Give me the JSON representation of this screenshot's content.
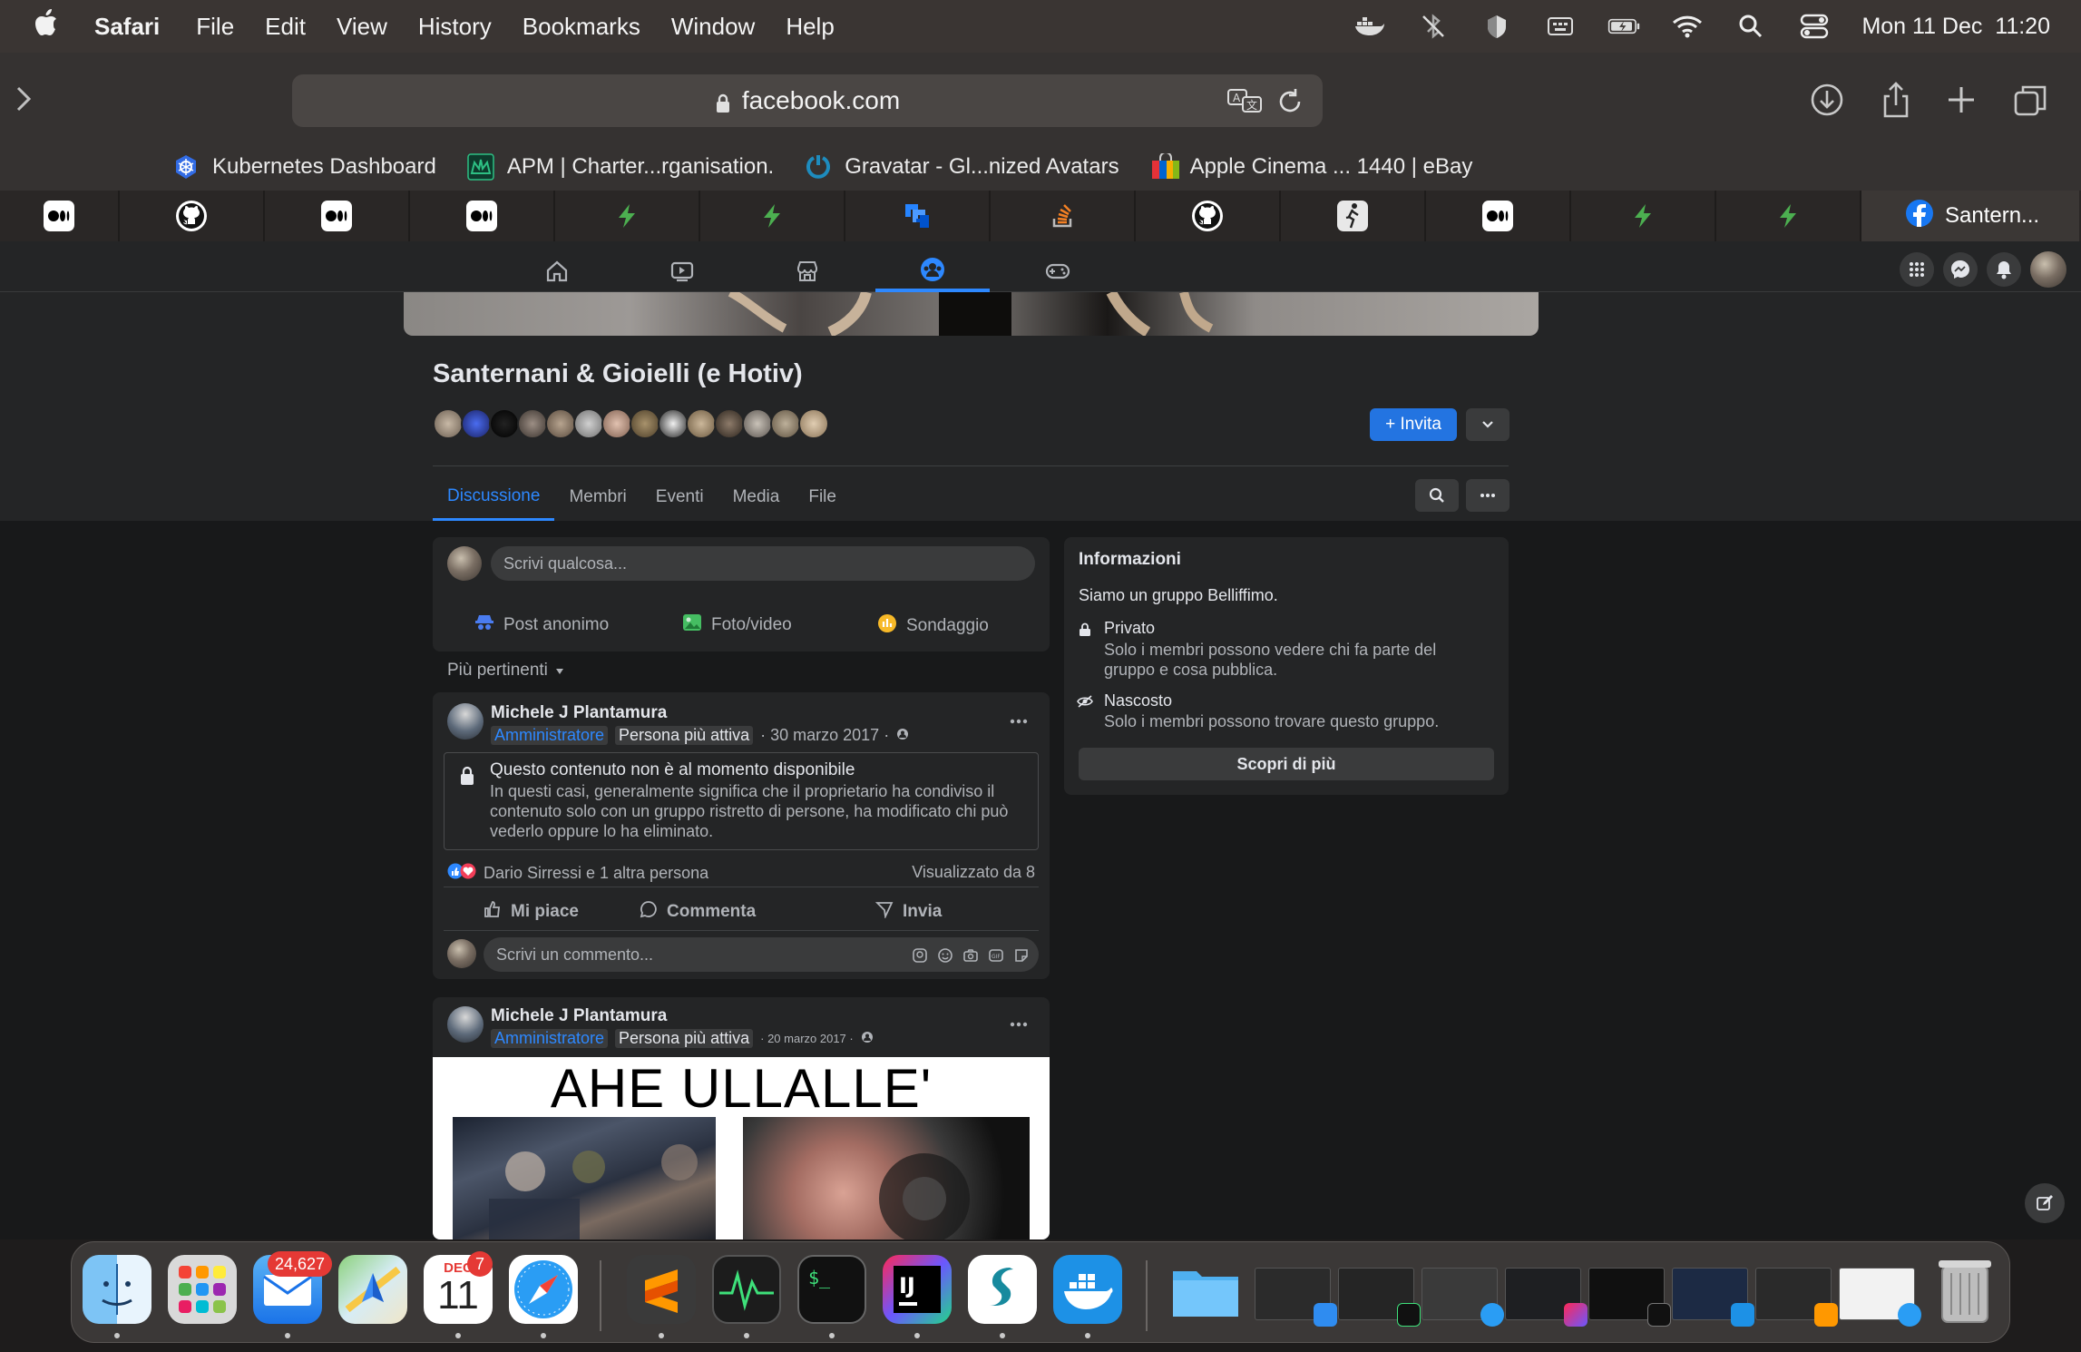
{
  "menubar": {
    "app": "Safari",
    "items": [
      "File",
      "Edit",
      "View",
      "History",
      "Bookmarks",
      "Window",
      "Help"
    ],
    "clock": "Mon 11 Dec  11:20"
  },
  "toolbar": {
    "url": "facebook.com",
    "favorites": [
      {
        "label": "Kubernetes Dashboard",
        "color": "#326ce5"
      },
      {
        "label": "APM | Charter...rganisation.",
        "color": "#1b6f4a"
      },
      {
        "label": "Gravatar - Gl...nized Avatars",
        "color": "#1e8cbe"
      },
      {
        "label": "Apple Cinema ... 1440 | eBay",
        "color": "#e53238"
      }
    ]
  },
  "tabs": {
    "active_label": "Santern..."
  },
  "group": {
    "title": "Santernani & Gioielli (e Hotiv)",
    "invite_label": "+ Invita",
    "tabs": [
      "Discussione",
      "Membri",
      "Eventi",
      "Media",
      "File"
    ]
  },
  "composer": {
    "placeholder": "Scrivi qualcosa...",
    "actions": [
      "Post anonimo",
      "Foto/video",
      "Sondaggio"
    ],
    "sort_label": "Più pertinenti"
  },
  "post1": {
    "author": "Michele J Plantamura",
    "role": "Amministratore",
    "badge": "Persona più attiva",
    "date": "· 30 marzo 2017 ·",
    "unavailable_title": "Questo contenuto non è al momento disponibile",
    "unavailable_body": "In questi casi, generalmente significa che il proprietario ha condiviso il contenuto solo con un gruppo ristretto di persone, ha modificato chi può vederlo oppure lo ha eliminato.",
    "reactions": "Dario Sirressi e 1 altra persona",
    "seen": "Visualizzato da 8",
    "like": "Mi piace",
    "comment": "Commenta",
    "share": "Invia",
    "comment_placeholder": "Scrivi un commento..."
  },
  "post2": {
    "author": "Michele J Plantamura",
    "role": "Amministratore",
    "badge": "Persona più attiva",
    "date": "· 20 marzo 2017 ·",
    "image_caption": "AHE ULLALLE'"
  },
  "info": {
    "title": "Informazioni",
    "description": "Siamo un gruppo Belliffimo.",
    "private_title": "Privato",
    "private_body": "Solo i membri possono vedere chi fa parte del gruppo e cosa pubblica.",
    "hidden_title": "Nascosto",
    "hidden_body": "Solo i membri possono trovare questo gruppo.",
    "more_button": "Scopri di più"
  },
  "dock": {
    "mail_badge": "24,627",
    "calendar_badge": "7",
    "calendar_month": "DEC",
    "calendar_day": "11"
  }
}
